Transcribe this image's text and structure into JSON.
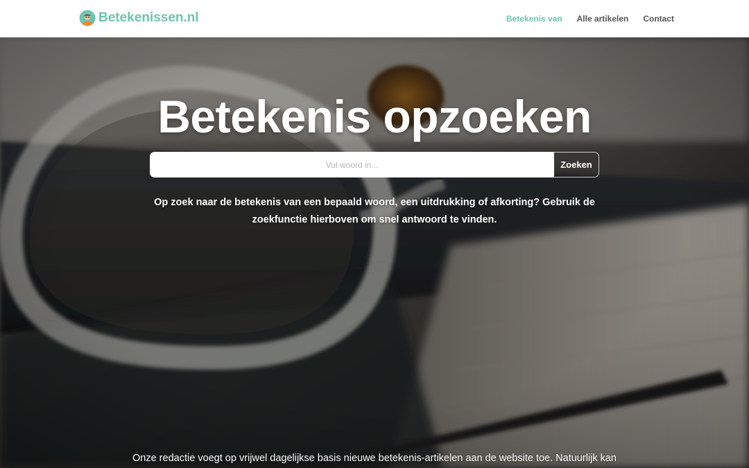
{
  "header": {
    "logo_text": "Betekenissen.nl",
    "nav": [
      {
        "label": "Betekenis van",
        "active": true
      },
      {
        "label": "Alle artikelen",
        "active": false
      },
      {
        "label": "Contact",
        "active": false
      }
    ]
  },
  "hero": {
    "title": "Betekenis opzoeken",
    "search": {
      "placeholder": "Vul woord in...",
      "value": "",
      "button_label": "Zoeken"
    },
    "intro": "Op zoek naar de betekenis van een bepaald woord, een uitdrukking of afkorting? Gebruik de zoekfunctie hierboven om snel antwoord te vinden.",
    "bottom_text": "Onze redactie voegt op vrijwel dagelijkse basis nieuwe betekenis-artikelen aan de website toe. Natuurlijk kan"
  },
  "colors": {
    "brand": "#6cc4b0",
    "nav_text": "#555555",
    "header_bg": "#ffffff",
    "hero_text": "#ffffff"
  },
  "icons": {
    "logo": "person-avatar-icon"
  }
}
